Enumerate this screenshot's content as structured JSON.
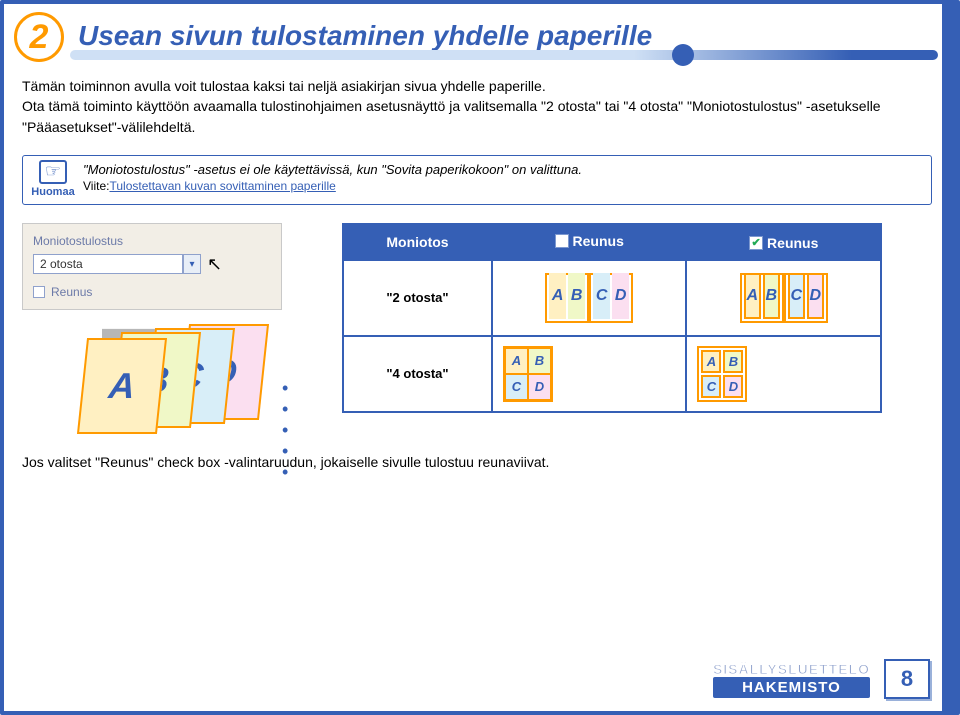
{
  "section_number": "2",
  "title": "Usean sivun tulostaminen yhdelle paperille",
  "intro_p1": "Tämän toiminnon avulla voit tulostaa kaksi tai neljä asiakirjan sivua yhdelle paperille.",
  "intro_p2": "Ota tämä toiminto käyttöön avaamalla tulostinohjaimen asetusnäyttö ja valitsemalla \"2 otosta\" tai \"4 otosta\" \"Moniotostulostus\" -asetukselle \"Pääasetukset\"-välilehdeltä.",
  "note": {
    "label": "Huomaa",
    "line1": "\"Moniotostulostus\" -asetus ei ole käytettävissä, kun \"Sovita paperikokoon\" on valittuna.",
    "ref_prefix": "Viite:",
    "ref_link": "Tulostettavan kuvan sovittaminen paperille"
  },
  "screenshot": {
    "label": "Moniotostulostus",
    "dropdown_value": "2 otosta",
    "checkbox_label": "Reunus"
  },
  "stack_letters": {
    "A": "A",
    "B": "B",
    "C": "C",
    "D": "D"
  },
  "table": {
    "col1": "Moniotos",
    "col2_label": "Reunus",
    "col3_label": "Reunus",
    "row1_label": "\"2 otosta\"",
    "row2_label": "\"4 otosta\""
  },
  "footnote": "Jos valitset \"Reunus\" check box -valintaruudun, jokaiselle sivulle tulostuu reunaviivat.",
  "footer": {
    "toc": "SISÄLLYSLUETTELO",
    "index": "HAKEMISTO",
    "page": "8"
  }
}
